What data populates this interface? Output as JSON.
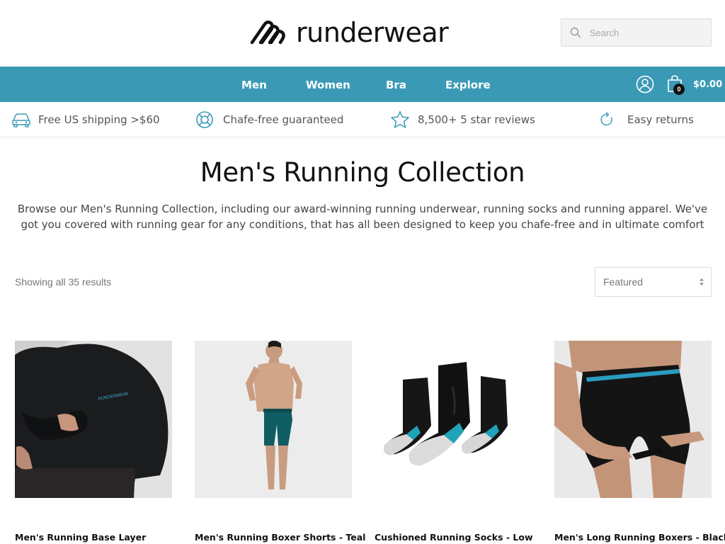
{
  "brand": {
    "name": "runderwear"
  },
  "search": {
    "placeholder": "Search"
  },
  "nav": {
    "items": [
      {
        "label": "Men"
      },
      {
        "label": "Women"
      },
      {
        "label": "Bra"
      },
      {
        "label": "Explore"
      }
    ],
    "cart_count": "0",
    "cart_total": "$0.00"
  },
  "benefits": [
    {
      "label": "Free US shipping >$60",
      "icon": "car-icon"
    },
    {
      "label": "Chafe-free guaranteed",
      "icon": "lifebuoy-icon"
    },
    {
      "label": "8,500+ 5 star reviews",
      "icon": "star-icon"
    },
    {
      "label": "Easy returns",
      "icon": "return-icon"
    }
  ],
  "page": {
    "title": "Men's Running Collection",
    "description": "Browse our Men's Running Collection, including our award-winning running underwear, running socks and running apparel. We've got you covered with running gear for any conditions, that has all been designed to keep you chafe-free and in ultimate comfort"
  },
  "results": {
    "count_text": "Showing all 35 results",
    "sort_selected": "Featured"
  },
  "products": [
    {
      "name": "Men's Running Base Layer"
    },
    {
      "name": "Men's Running Boxer Shorts - Teal"
    },
    {
      "name": "Cushioned Running Socks - Low"
    },
    {
      "name": "Men's Long Running Boxers - Black"
    }
  ],
  "colors": {
    "nav_bg": "#3a9ab6",
    "accent": "#3a9ab6"
  }
}
